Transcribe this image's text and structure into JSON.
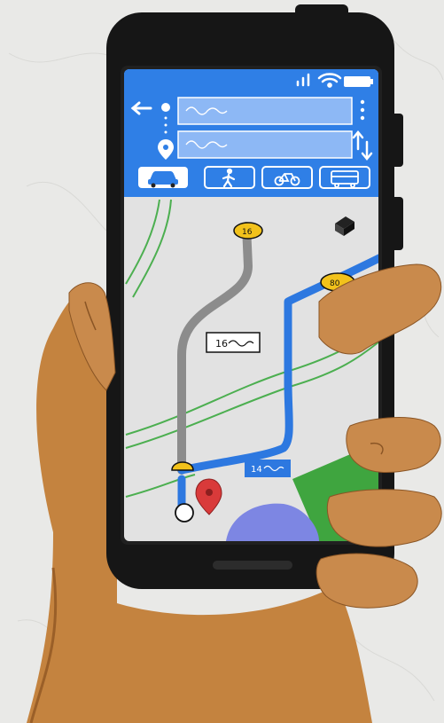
{
  "status_bar": {
    "icons": [
      "signal-icon",
      "wifi-icon",
      "battery-icon"
    ]
  },
  "search": {
    "origin_value": "",
    "destination_value": ""
  },
  "modes": [
    {
      "name": "car",
      "icon": "car-icon",
      "selected": true
    },
    {
      "name": "walk",
      "icon": "walk-icon",
      "selected": false
    },
    {
      "name": "bike",
      "icon": "bike-icon",
      "selected": false
    },
    {
      "name": "transit",
      "icon": "bus-icon",
      "selected": false
    }
  ],
  "map": {
    "highway_badges": [
      "16",
      "80"
    ],
    "route_labels": [
      "16",
      "14"
    ]
  },
  "colors": {
    "header_blue": "#2f7fe6",
    "route_blue": "#2d78e0",
    "road_gray": "#8c8c8c",
    "skin": "#c98a4c",
    "phone": "#161616",
    "marker_red": "#d93a3a",
    "badge_yellow": "#f2c21b"
  }
}
